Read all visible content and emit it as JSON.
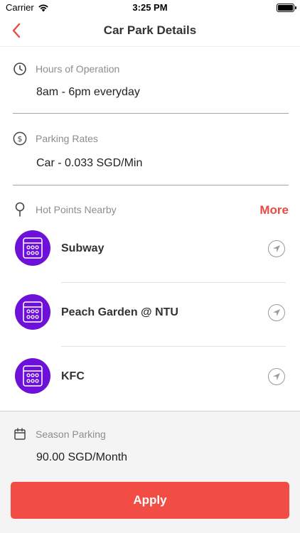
{
  "status_bar": {
    "carrier": "Carrier",
    "time": "3:25 PM"
  },
  "nav": {
    "title": "Car Park Details"
  },
  "hours": {
    "label": "Hours of Operation",
    "value": "8am - 6pm everyday",
    "icon": "clock-icon"
  },
  "rates": {
    "label": "Parking Rates",
    "value": "Car - 0.033 SGD/Min",
    "icon": "dollar-icon"
  },
  "hot_points": {
    "label": "Hot Points Nearby",
    "more_label": "More",
    "icon": "pin-icon",
    "items": [
      {
        "name": "Subway"
      },
      {
        "name": "Peach Garden @ NTU"
      },
      {
        "name": "KFC"
      }
    ]
  },
  "season": {
    "label": "Season Parking",
    "value": "90.00 SGD/Month",
    "icon": "calendar-icon"
  },
  "apply": {
    "label": "Apply"
  },
  "colors": {
    "accent": "#f24d45",
    "more": "#e94b43",
    "avatar": "#6e11d8",
    "panel": "#f4f4f4"
  }
}
